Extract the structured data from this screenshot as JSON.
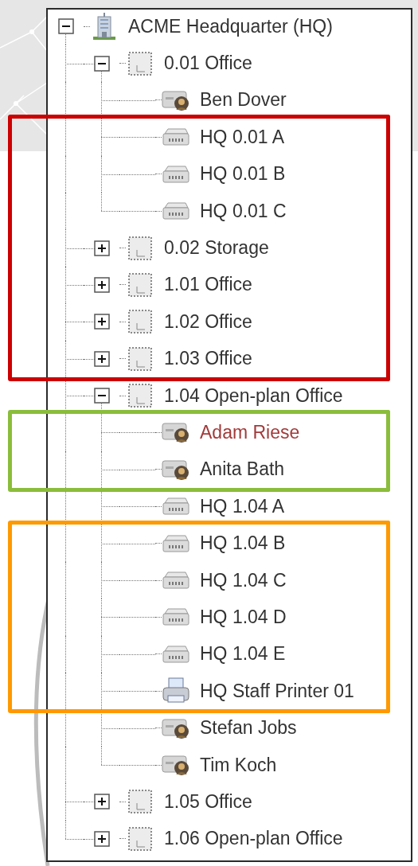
{
  "tree": {
    "label": "ACME Headquarter (HQ)",
    "kind": "building",
    "expanded": true,
    "marked": false,
    "children": [
      {
        "label": "0.01 Office",
        "kind": "room",
        "expanded": true,
        "marked": false,
        "children": [
          {
            "label": "Ben Dover",
            "kind": "person",
            "marked": false
          },
          {
            "label": "HQ 0.01 A",
            "kind": "device",
            "marked": false,
            "color": "#cc0000"
          },
          {
            "label": "HQ 0.01 B",
            "kind": "device",
            "marked": false,
            "color": "#cc0000"
          },
          {
            "label": "HQ 0.01 C",
            "kind": "device",
            "marked": false,
            "color": "#cc0000"
          }
        ]
      },
      {
        "label": "0.02 Storage",
        "kind": "room",
        "expanded": false,
        "marked": false,
        "color": "#cc0000"
      },
      {
        "label": "1.01 Office",
        "kind": "room",
        "expanded": false,
        "marked": false,
        "color": "#cc0000"
      },
      {
        "label": "1.02 Office",
        "kind": "room",
        "expanded": false,
        "marked": false,
        "color": "#cc0000"
      },
      {
        "label": "1.03 Office",
        "kind": "room",
        "expanded": false,
        "marked": false,
        "color": "#cc0000"
      },
      {
        "label": "1.04 Open-plan Office",
        "kind": "room",
        "expanded": true,
        "marked": false,
        "children": [
          {
            "label": "Adam Riese",
            "kind": "person",
            "marked": true,
            "color": "#8bbd3c"
          },
          {
            "label": "Anita Bath",
            "kind": "person",
            "marked": false,
            "color": "#8bbd3c"
          },
          {
            "label": "HQ 1.04 A",
            "kind": "device",
            "marked": false
          },
          {
            "label": "HQ 1.04 B",
            "kind": "device",
            "marked": false,
            "color": "#ff9900"
          },
          {
            "label": "HQ 1.04 C",
            "kind": "device",
            "marked": false,
            "color": "#ff9900"
          },
          {
            "label": "HQ 1.04 D",
            "kind": "device",
            "marked": false,
            "color": "#ff9900"
          },
          {
            "label": "HQ 1.04 E",
            "kind": "device",
            "marked": false,
            "color": "#ff9900"
          },
          {
            "label": "HQ Staff Printer 01",
            "kind": "printer",
            "marked": false,
            "color": "#ff9900"
          },
          {
            "label": "Stefan Jobs",
            "kind": "person",
            "marked": false
          },
          {
            "label": "Tim Koch",
            "kind": "person",
            "marked": false
          }
        ]
      },
      {
        "label": "1.05 Office",
        "kind": "room",
        "expanded": false,
        "marked": false
      },
      {
        "label": "1.06 Open-plan Office",
        "kind": "room",
        "expanded": false,
        "marked": false
      }
    ]
  }
}
